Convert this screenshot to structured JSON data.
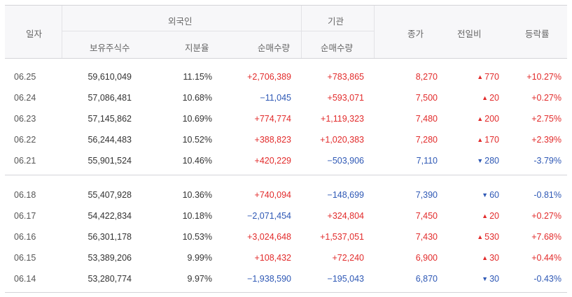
{
  "headers": {
    "date": "일자",
    "foreign_group": "외국인",
    "institution_group": "기관",
    "holdings": "보유주식수",
    "ratio": "지분율",
    "foreign_net": "순매수량",
    "inst_net": "순매수량",
    "close": "종가",
    "change": "전일비",
    "rate": "등락률"
  },
  "group1": [
    {
      "date": "06.25",
      "holdings": "59,610,049",
      "ratio": "11.15%",
      "foreign_net": "+2,706,389",
      "inst_net": "+783,865",
      "close": "8,270",
      "dir": "up",
      "change": "770",
      "rate": "+10.27%"
    },
    {
      "date": "06.24",
      "holdings": "57,086,481",
      "ratio": "10.68%",
      "foreign_net": "−11,045",
      "inst_net": "+593,071",
      "close": "7,500",
      "dir": "up",
      "change": "20",
      "rate": "+0.27%"
    },
    {
      "date": "06.23",
      "holdings": "57,145,862",
      "ratio": "10.69%",
      "foreign_net": "+774,774",
      "inst_net": "+1,119,323",
      "close": "7,480",
      "dir": "up",
      "change": "200",
      "rate": "+2.75%"
    },
    {
      "date": "06.22",
      "holdings": "56,244,483",
      "ratio": "10.52%",
      "foreign_net": "+388,823",
      "inst_net": "+1,020,383",
      "close": "7,280",
      "dir": "up",
      "change": "170",
      "rate": "+2.39%"
    },
    {
      "date": "06.21",
      "holdings": "55,901,524",
      "ratio": "10.46%",
      "foreign_net": "+420,229",
      "inst_net": "−503,906",
      "close": "7,110",
      "dir": "down",
      "change": "280",
      "rate": "-3.79%"
    }
  ],
  "group2": [
    {
      "date": "06.18",
      "holdings": "55,407,928",
      "ratio": "10.36%",
      "foreign_net": "+740,094",
      "inst_net": "−148,699",
      "close": "7,390",
      "dir": "down",
      "change": "60",
      "rate": "-0.81%"
    },
    {
      "date": "06.17",
      "holdings": "54,422,834",
      "ratio": "10.18%",
      "foreign_net": "−2,071,454",
      "inst_net": "+324,804",
      "close": "7,450",
      "dir": "up",
      "change": "20",
      "rate": "+0.27%"
    },
    {
      "date": "06.16",
      "holdings": "56,301,178",
      "ratio": "10.53%",
      "foreign_net": "+3,024,648",
      "inst_net": "+1,537,051",
      "close": "7,430",
      "dir": "up",
      "change": "530",
      "rate": "+7.68%"
    },
    {
      "date": "06.15",
      "holdings": "53,389,206",
      "ratio": "9.99%",
      "foreign_net": "+108,432",
      "inst_net": "+72,240",
      "close": "6,900",
      "dir": "up",
      "change": "30",
      "rate": "+0.44%"
    },
    {
      "date": "06.14",
      "holdings": "53,280,774",
      "ratio": "9.97%",
      "foreign_net": "−1,938,590",
      "inst_net": "−195,043",
      "close": "6,870",
      "dir": "down",
      "change": "30",
      "rate": "-0.43%"
    }
  ],
  "colors": {
    "up": "#e22b2b",
    "down": "#2e58b5",
    "header_bg": "#f7f7f9"
  },
  "icons": {
    "up": "triangle-up-icon",
    "down": "triangle-down-icon"
  }
}
